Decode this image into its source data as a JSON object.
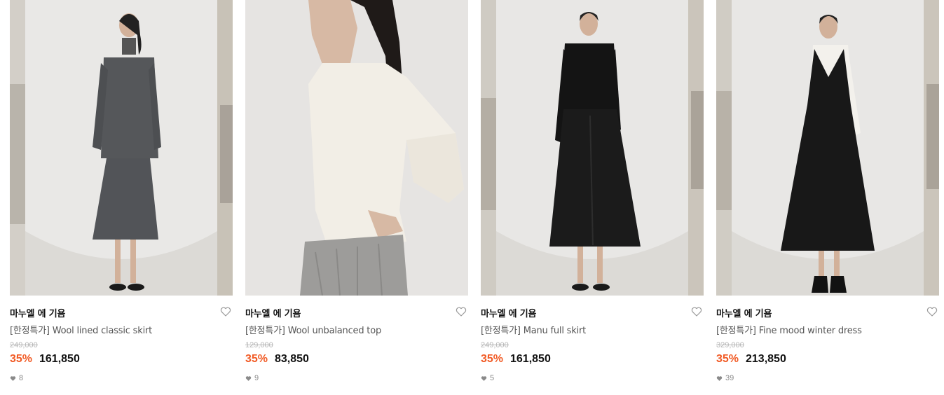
{
  "colors": {
    "discount": "#f15a24",
    "price": "#111111",
    "original_price": "#b5b5b5",
    "muted": "#8a8a8a"
  },
  "products": [
    {
      "image": "model in grey wool double-breasted blazer and grey midi skirt",
      "brand": "마누엘 에 기욤",
      "name": "[한정특가] Wool lined classic skirt",
      "original_price": "249,000",
      "discount": "35%",
      "price": "161,850",
      "likes": "8",
      "heart_icon": "heart-outline-icon",
      "like_icon": "heart-filled-icon"
    },
    {
      "image": "model in ivory ribbed long-sleeve top, close-up",
      "brand": "마누엘 에 기욤",
      "name": "[한정특가] Wool unbalanced top",
      "original_price": "129,000",
      "discount": "35%",
      "price": "83,850",
      "likes": "9",
      "heart_icon": "heart-outline-icon",
      "like_icon": "heart-filled-icon"
    },
    {
      "image": "model in black turtleneck and black buttoned full skirt",
      "brand": "마누엘 에 기욤",
      "name": "[한정특가] Manu full skirt",
      "original_price": "249,000",
      "discount": "35%",
      "price": "161,850",
      "likes": "5",
      "heart_icon": "heart-outline-icon",
      "like_icon": "heart-filled-icon"
    },
    {
      "image": "model in white shirt under black sleeveless maxi dress",
      "brand": "마누엘 에 기욤",
      "name": "[한정특가] Fine mood winter dress",
      "original_price": "329,000",
      "discount": "35%",
      "price": "213,850",
      "likes": "39",
      "heart_icon": "heart-outline-icon",
      "like_icon": "heart-filled-icon"
    }
  ]
}
